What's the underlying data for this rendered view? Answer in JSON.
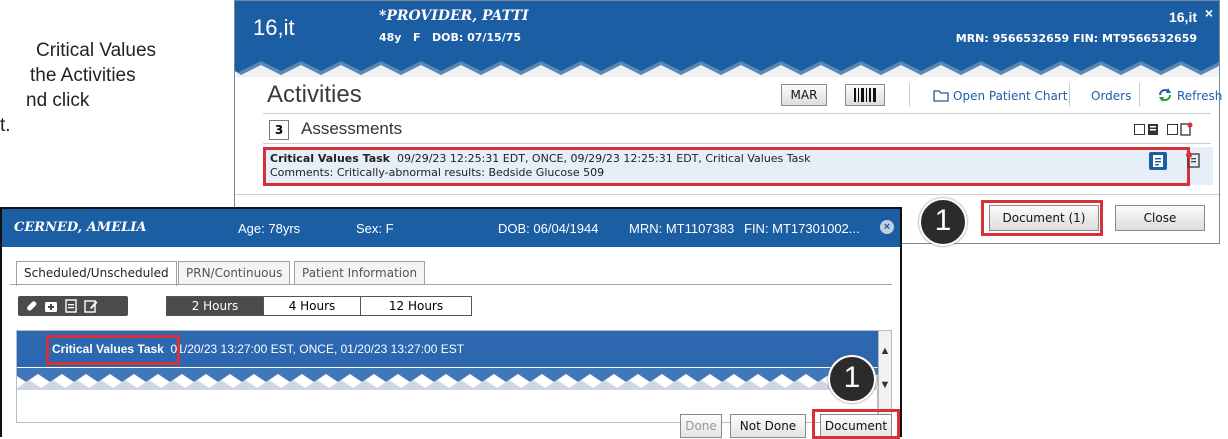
{
  "instructions": {
    "line1": "Critical Values",
    "line2": "the Activities",
    "line3": "nd click",
    "line4": "t."
  },
  "activities_window": {
    "tab_label": "16,it",
    "patient_name": "*PROVIDER, PATTI",
    "demographics": "48y   F   DOB: 07/15/75",
    "right_label": "16,it",
    "close_glyph": "×",
    "mrn_fin": "MRN: 9566532659  FIN: MT9566532659",
    "title": "Activities",
    "toolbar": {
      "mar_label": "MAR",
      "open_chart_label": "Open Patient Chart",
      "orders_label": "Orders",
      "refresh_label": "Refresh"
    },
    "section": {
      "count": "3",
      "label": "Assessments"
    },
    "task": {
      "name": "Critical Values Task",
      "details": "09/29/23 12:25:31 EDT, ONCE, 09/29/23 12:25:31 EDT, Critical Values Task",
      "comments": "Comments: Critically-abnormal results: Bedside Glucose 509"
    },
    "callout": "1",
    "document_label": "Document (1)",
    "close_label": "Close"
  },
  "mar_window": {
    "patient_name": "CERNED, AMELIA",
    "age": "Age: 78yrs",
    "sex": "Sex: F",
    "dob": "DOB: 06/04/1944",
    "mrn": "MRN: MT1107383",
    "fin": "FIN: MT17301002...",
    "close_glyph": "×",
    "tabs": [
      "Scheduled/Unscheduled",
      "PRN/Continuous",
      "Patient Information"
    ],
    "time_filters": [
      "2 Hours",
      "4 Hours",
      "12 Hours"
    ],
    "task": {
      "name": "Critical Values Task",
      "details": "01/20/23 13:27:00 EST, ONCE, 01/20/23 13:27:00 EST"
    },
    "callout": "1",
    "buttons": {
      "done": "Done",
      "not_done": "Not Done",
      "document": "Document"
    }
  },
  "colors": {
    "header_blue": "#1c5ea4",
    "highlight_red": "#d6303b",
    "selected_row": "#2c67b0"
  }
}
